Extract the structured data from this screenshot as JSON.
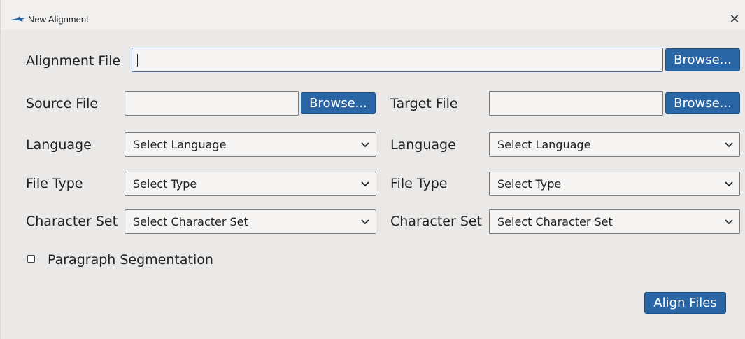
{
  "window": {
    "title": "New Alignment",
    "close_glyph": "✕",
    "app_icon": "alignment-app-icon"
  },
  "alignment": {
    "label": "Alignment File",
    "value": "",
    "browse_label": "Browse..."
  },
  "source": {
    "file_label": "Source File",
    "file_value": "",
    "browse_label": "Browse...",
    "language_label": "Language",
    "language_value": "Select Language",
    "type_label": "File Type",
    "type_value": "Select Type",
    "charset_label": "Character Set",
    "charset_value": "Select Character Set"
  },
  "target": {
    "file_label": "Target File",
    "file_value": "",
    "browse_label": "Browse...",
    "language_label": "Language",
    "language_value": "Select Language",
    "type_label": "File Type",
    "type_value": "Select Type",
    "charset_label": "Character Set",
    "charset_value": "Select Character Set"
  },
  "options": {
    "paragraph_segmentation_label": "Paragraph Segmentation",
    "paragraph_segmentation_checked": false
  },
  "actions": {
    "align_label": "Align Files"
  },
  "colors": {
    "accent": "#2a66a6",
    "background": "#ebe9e7",
    "titlebar": "#f1f0ef"
  },
  "icons": {
    "dropdown": "chevron-down-icon",
    "close": "close-icon",
    "checkbox": "checkbox-icon"
  }
}
